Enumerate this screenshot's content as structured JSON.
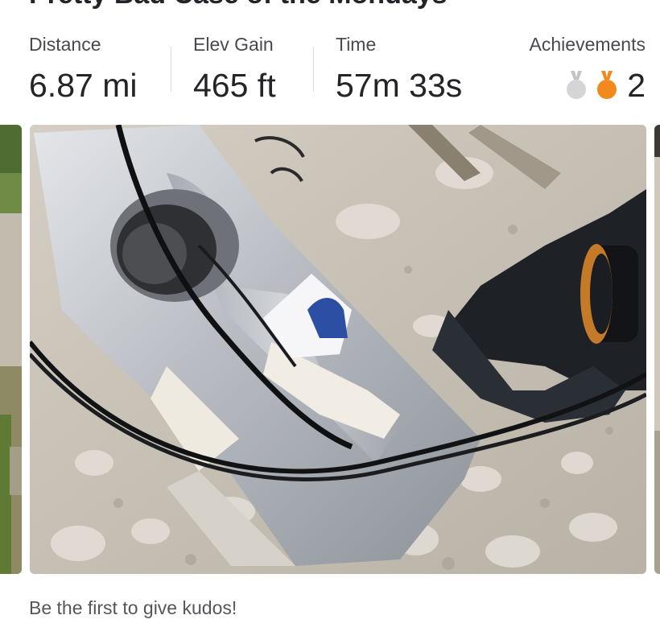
{
  "activity": {
    "title": "Pretty Bad Case of the Mondays"
  },
  "stats": {
    "distance": {
      "label": "Distance",
      "value": "6.87 mi"
    },
    "elev_gain": {
      "label": "Elev Gain",
      "value": "465 ft"
    },
    "time": {
      "label": "Time",
      "value": "57m 33s"
    },
    "achievements": {
      "label": "Achievements",
      "count": "2",
      "medals": [
        "silver-medal-icon",
        "bronze-medal-icon"
      ]
    }
  },
  "photo": {
    "subject": "broken bicycle fork crown with cables on gravel"
  },
  "kudos": {
    "prompt": "Be the first to give kudos!"
  },
  "colors": {
    "text_primary": "#242428",
    "text_secondary": "#494950",
    "silver_medal": "#d5d5d8",
    "bronze_medal": "#f2891f"
  }
}
